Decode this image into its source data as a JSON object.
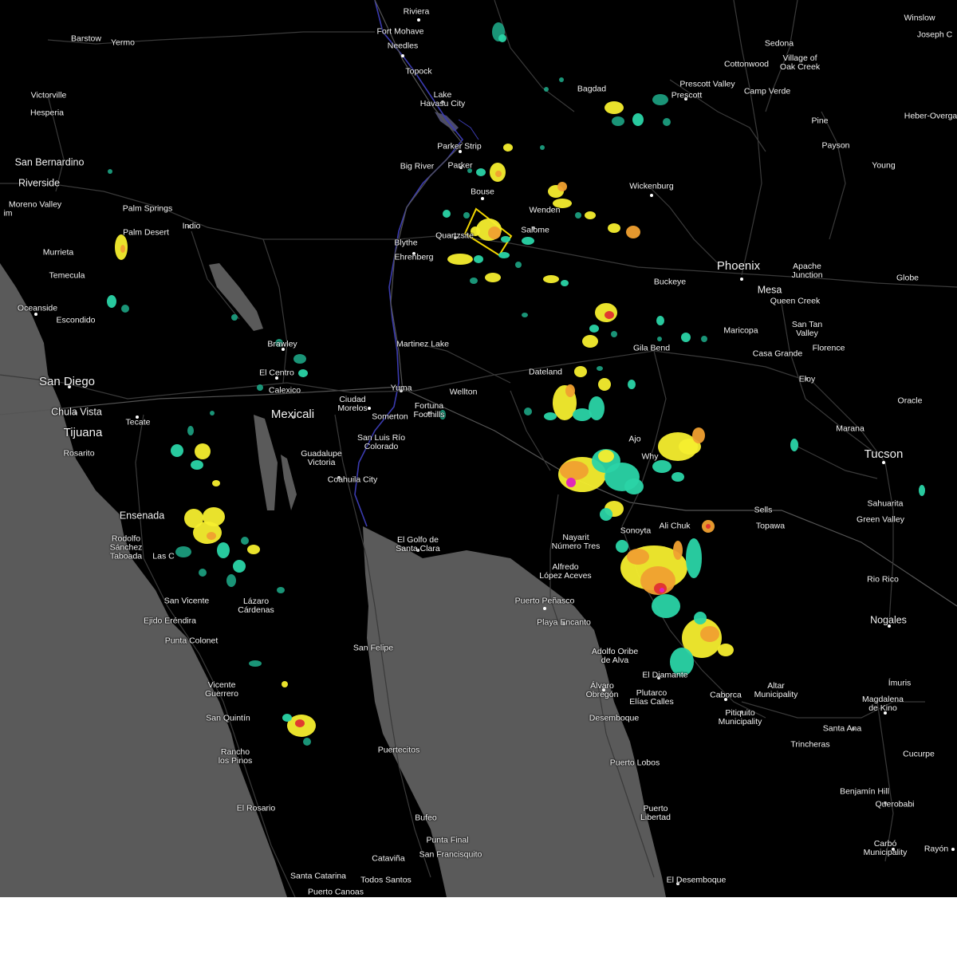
{
  "colors": {
    "land": "#000000",
    "water": "#5a5a5a",
    "roads": "#3a3a3a",
    "border": "#4a4a4a",
    "river": "#3b3bb0",
    "warning_polygon": "#f2d600",
    "radar_light": "#1fae8c",
    "radar_mid": "#2ad4a7",
    "radar_yellow": "#f5ee2e",
    "radar_orange": "#f0a030",
    "radar_red": "#e03030",
    "radar_magenta": "#e020c0"
  },
  "cities": [
    {
      "name": "Riviera",
      "size": "sm"
    },
    {
      "name": "Fort Mohave",
      "size": "sm"
    },
    {
      "name": "Needles",
      "size": "sm"
    },
    {
      "name": "Topock",
      "size": "sm"
    },
    {
      "name": "Lake\nHavasu City",
      "size": "sm"
    },
    {
      "name": "Parker Strip",
      "size": "sm"
    },
    {
      "name": "Big River",
      "size": "sm"
    },
    {
      "name": "Parker",
      "size": "sm"
    },
    {
      "name": "Bouse",
      "size": "sm"
    },
    {
      "name": "Quartzsite",
      "size": "sm"
    },
    {
      "name": "Blythe",
      "size": "sm"
    },
    {
      "name": "Ehrenberg",
      "size": "sm"
    },
    {
      "name": "Wenden",
      "size": "sm"
    },
    {
      "name": "Salome",
      "size": "sm"
    },
    {
      "name": "Wickenburg",
      "size": "sm"
    },
    {
      "name": "Bagdad",
      "size": "sm"
    },
    {
      "name": "Prescott Valley",
      "size": "sm"
    },
    {
      "name": "Prescott",
      "size": "sm"
    },
    {
      "name": "Sedona",
      "size": "sm"
    },
    {
      "name": "Cottonwood",
      "size": "sm"
    },
    {
      "name": "Village of\nOak Creek",
      "size": "sm"
    },
    {
      "name": "Camp Verde",
      "size": "sm"
    },
    {
      "name": "Winslow",
      "size": "sm"
    },
    {
      "name": "Joseph C",
      "size": "sm"
    },
    {
      "name": "Pine",
      "size": "sm"
    },
    {
      "name": "Payson",
      "size": "sm"
    },
    {
      "name": "Heber-Overga",
      "size": "sm"
    },
    {
      "name": "Young",
      "size": "sm"
    },
    {
      "name": "Phoenix",
      "size": "big"
    },
    {
      "name": "Mesa",
      "size": "med"
    },
    {
      "name": "Apache\nJunction",
      "size": "sm"
    },
    {
      "name": "Buckeye",
      "size": "sm"
    },
    {
      "name": "Globe",
      "size": "sm"
    },
    {
      "name": "Queen Creek",
      "size": "sm"
    },
    {
      "name": "San Tan\nValley",
      "size": "sm"
    },
    {
      "name": "Florence",
      "size": "sm"
    },
    {
      "name": "Maricopa",
      "size": "sm"
    },
    {
      "name": "Casa Grande",
      "size": "sm"
    },
    {
      "name": "Gila Bend",
      "size": "sm"
    },
    {
      "name": "Eloy",
      "size": "sm"
    },
    {
      "name": "Oracle",
      "size": "sm"
    },
    {
      "name": "Marana",
      "size": "sm"
    },
    {
      "name": "Tucson",
      "size": "big"
    },
    {
      "name": "Sahuarita",
      "size": "sm"
    },
    {
      "name": "Green Valley",
      "size": "sm"
    },
    {
      "name": "Rio Rico",
      "size": "sm"
    },
    {
      "name": "Nogales",
      "size": "med"
    },
    {
      "name": "Sells",
      "size": "sm"
    },
    {
      "name": "Topawa",
      "size": "sm"
    },
    {
      "name": "Ajo",
      "size": "sm"
    },
    {
      "name": "Why",
      "size": "sm"
    },
    {
      "name": "Ali Chuk",
      "size": "sm"
    },
    {
      "name": "Sonoyta",
      "size": "sm"
    },
    {
      "name": "Dateland",
      "size": "sm"
    },
    {
      "name": "Martinez Lake",
      "size": "sm"
    },
    {
      "name": "Yuma",
      "size": "sm"
    },
    {
      "name": "Wellton",
      "size": "sm"
    },
    {
      "name": "Fortuna\nFoothills",
      "size": "sm"
    },
    {
      "name": "Somerton",
      "size": "sm"
    },
    {
      "name": "Ciudad\nMorelos",
      "size": "sm"
    },
    {
      "name": "San Luis Río\nColorado",
      "size": "sm"
    },
    {
      "name": "Barstow",
      "size": "sm"
    },
    {
      "name": "Yermo",
      "size": "sm"
    },
    {
      "name": "Victorville",
      "size": "sm"
    },
    {
      "name": "Hesperia",
      "size": "sm"
    },
    {
      "name": "San Bernardino",
      "size": "med"
    },
    {
      "name": "Riverside",
      "size": "med"
    },
    {
      "name": "Moreno Valley",
      "size": "sm"
    },
    {
      "name": "im",
      "size": "sm"
    },
    {
      "name": "Palm Springs",
      "size": "sm"
    },
    {
      "name": "Palm Desert",
      "size": "sm"
    },
    {
      "name": "Indio",
      "size": "sm"
    },
    {
      "name": "Murrieta",
      "size": "sm"
    },
    {
      "name": "Temecula",
      "size": "sm"
    },
    {
      "name": "Oceanside",
      "size": "sm"
    },
    {
      "name": "Escondido",
      "size": "sm"
    },
    {
      "name": "San Diego",
      "size": "big"
    },
    {
      "name": "Chula Vista",
      "size": "med"
    },
    {
      "name": "Tijuana",
      "size": "big"
    },
    {
      "name": "Rosarito",
      "size": "sm"
    },
    {
      "name": "Tecate",
      "size": "sm"
    },
    {
      "name": "Brawley",
      "size": "sm"
    },
    {
      "name": "El Centro",
      "size": "sm"
    },
    {
      "name": "Calexico",
      "size": "sm"
    },
    {
      "name": "Mexicali",
      "size": "big"
    },
    {
      "name": "Guadalupe\nVictoria",
      "size": "sm"
    },
    {
      "name": "Coahuila City",
      "size": "sm"
    },
    {
      "name": "El Golfo de\nSanta Clara",
      "size": "sm"
    },
    {
      "name": "Ensenada",
      "size": "med"
    },
    {
      "name": "Rodolfo\nSánchez\nTaboada",
      "size": "sm"
    },
    {
      "name": "Las C",
      "size": "sm"
    },
    {
      "name": "San Vicente",
      "size": "sm"
    },
    {
      "name": "Ejido Eréndira",
      "size": "sm"
    },
    {
      "name": "Lázaro\nCárdenas",
      "size": "sm"
    },
    {
      "name": "Punta Colonet",
      "size": "sm"
    },
    {
      "name": "Vicente\nGuerrero",
      "size": "sm"
    },
    {
      "name": "San Quintín",
      "size": "sm"
    },
    {
      "name": "Rancho\nlos Pinos",
      "size": "sm"
    },
    {
      "name": "San Felipe",
      "size": "sm"
    },
    {
      "name": "Puertecitos",
      "size": "sm"
    },
    {
      "name": "El Rosario",
      "size": "sm"
    },
    {
      "name": "Bufeo",
      "size": "sm"
    },
    {
      "name": "Punta Final",
      "size": "sm"
    },
    {
      "name": "Cataviña",
      "size": "sm"
    },
    {
      "name": "San Francisquito",
      "size": "sm"
    },
    {
      "name": "Santa Catarina",
      "size": "sm"
    },
    {
      "name": "Todos Santos",
      "size": "sm"
    },
    {
      "name": "Puerto Canoas",
      "size": "sm"
    },
    {
      "name": "Nayarit\nNúmero Tres",
      "size": "sm"
    },
    {
      "name": "Alfredo\nLópez Aceves",
      "size": "sm"
    },
    {
      "name": "Puerto Peñasco",
      "size": "sm"
    },
    {
      "name": "Playa Encanto",
      "size": "sm"
    },
    {
      "name": "Adolfo Oribe\nde Alva",
      "size": "sm"
    },
    {
      "name": "El Diamante",
      "size": "sm"
    },
    {
      "name": "Álvaro\nObregón",
      "size": "sm"
    },
    {
      "name": "Plutarco\nElías Calles",
      "size": "sm"
    },
    {
      "name": "Caborca",
      "size": "sm"
    },
    {
      "name": "Pitiquito\nMunicipality",
      "size": "sm"
    },
    {
      "name": "Altar\nMunicipality",
      "size": "sm"
    },
    {
      "name": "Desemboque",
      "size": "sm"
    },
    {
      "name": "Puerto Lobos",
      "size": "sm"
    },
    {
      "name": "Puerto\nLibertad",
      "size": "sm"
    },
    {
      "name": "El Desemboque",
      "size": "sm"
    },
    {
      "name": "Santa Ana",
      "size": "sm"
    },
    {
      "name": "Trincheras",
      "size": "sm"
    },
    {
      "name": "Ímuris",
      "size": "sm"
    },
    {
      "name": "Magdalena\nde Kino",
      "size": "sm"
    },
    {
      "name": "Cucurpe",
      "size": "sm"
    },
    {
      "name": "Benjamín Hill",
      "size": "sm"
    },
    {
      "name": "Querobabi",
      "size": "sm"
    },
    {
      "name": "Carbó\nMunicipality",
      "size": "sm"
    },
    {
      "name": "Rayón",
      "size": "sm"
    }
  ]
}
